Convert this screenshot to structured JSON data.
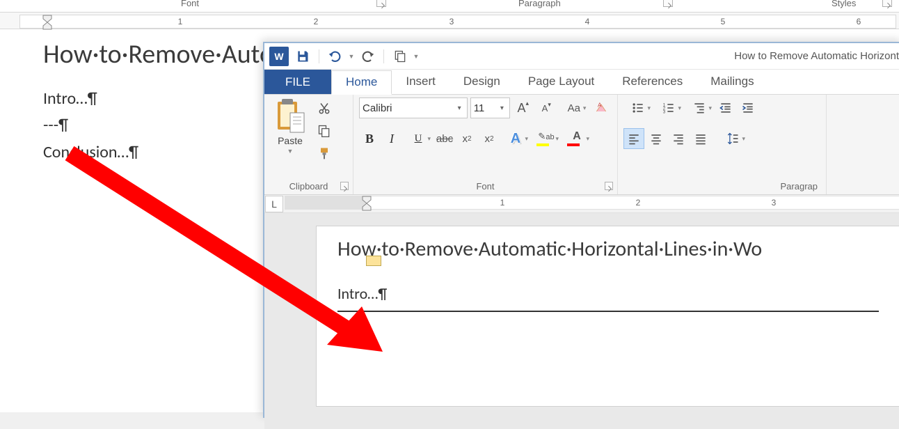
{
  "back_window": {
    "group_font": "Font",
    "group_paragraph": "Paragraph",
    "group_styles": "Styles",
    "ruler_numbers": [
      "1",
      "2",
      "3",
      "4",
      "5",
      "6"
    ],
    "doc_heading": "How·to·Remove·Auto",
    "doc_intro": "Intro…¶",
    "doc_dashes": "---¶",
    "doc_conclusion": "Conclusion…¶"
  },
  "front_window": {
    "title": "How to Remove Automatic Horizont",
    "tabs": {
      "file": "FILE",
      "home": "Home",
      "insert": "Insert",
      "design": "Design",
      "page_layout": "Page Layout",
      "references": "References",
      "mailings": "Mailings"
    },
    "clipboard": {
      "paste_label": "Paste",
      "group_label": "Clipboard"
    },
    "font": {
      "name": "Calibri",
      "size": "11",
      "grow": "A",
      "shrink": "A",
      "changecase": "Aa",
      "group_label": "Font",
      "bold": "B",
      "italic": "I",
      "underline": "U",
      "strike": "abc",
      "sub": "x",
      "sub2": "2",
      "sup": "x",
      "sup2": "2",
      "text_effects": "A",
      "highlight": "ab",
      "font_color": "A"
    },
    "paragraph": {
      "group_label": "Paragrap"
    },
    "ruler_numbers": [
      "1",
      "2",
      "3"
    ],
    "doc_heading": "How·to·Remove·Automatic·Horizontal·Lines·in·Wo",
    "doc_intro": "Intro…¶",
    "doc_blank": "¶"
  }
}
